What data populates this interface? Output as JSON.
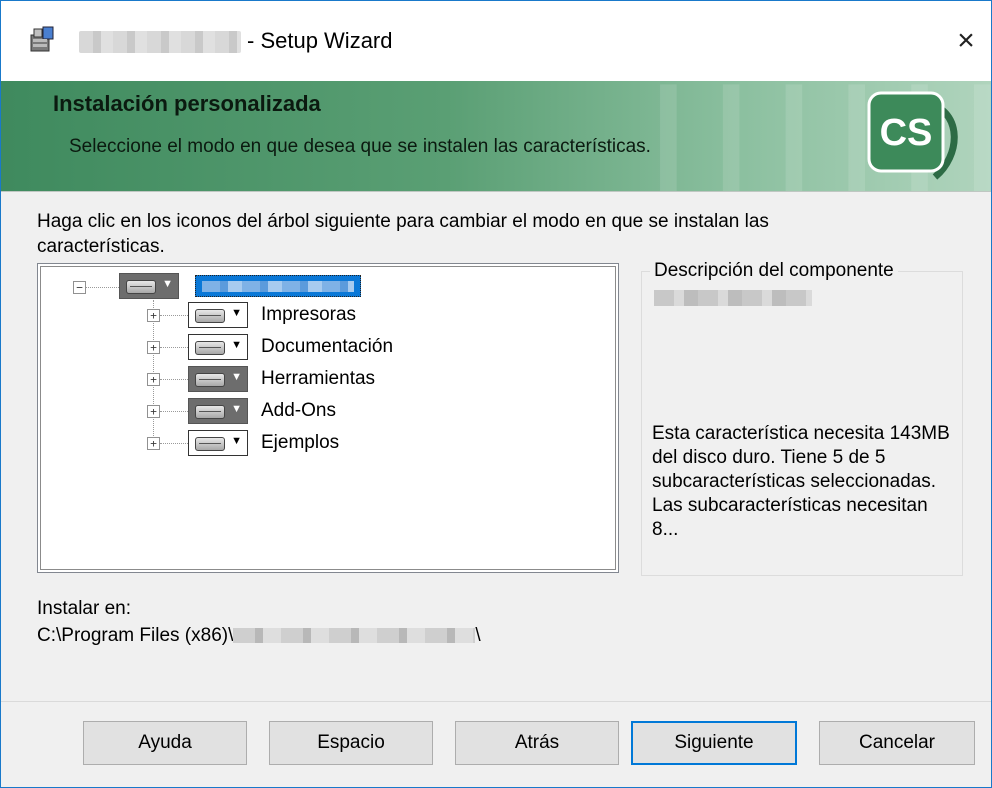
{
  "window": {
    "title": "- Setup Wizard",
    "close_glyph": "×"
  },
  "banner": {
    "title": "Instalación personalizada",
    "subtitle": "Seleccione el modo en que desea que se instalen las características.",
    "logo_text": "CS"
  },
  "instructions": "Haga clic en los iconos del árbol siguiente para cambiar el modo en que se instalan las características.",
  "tree": {
    "root_expander": "−",
    "items": [
      {
        "label": "Impresoras",
        "expander": "+",
        "selected": false
      },
      {
        "label": "Documentación",
        "expander": "+",
        "selected": false
      },
      {
        "label": "Herramientas",
        "expander": "+",
        "selected": true
      },
      {
        "label": "Add-Ons",
        "expander": "+",
        "selected": true
      },
      {
        "label": "Ejemplos",
        "expander": "+",
        "selected": false
      }
    ]
  },
  "description": {
    "legend": "Descripción del componente",
    "text": "Esta característica necesita 143MB del disco duro. Tiene 5 de 5 subcaracterísticas seleccionadas. Las subcaracterísticas necesitan 8..."
  },
  "install": {
    "label": "Instalar en:",
    "path_prefix": "C:\\Program Files (x86)\\",
    "path_suffix": "\\"
  },
  "buttons": {
    "help": "Ayuda",
    "space": "Espacio",
    "back": "Atrás",
    "next": "Siguiente",
    "cancel": "Cancelar"
  },
  "icons": {
    "app": "installer-icon",
    "feature": "hard-drive-icon",
    "dropdown": "▼"
  },
  "colors": {
    "banner": "#4f9468",
    "selection": "#0a78d7",
    "default_button_border": "#0078d7",
    "window_border": "#1979ca"
  }
}
